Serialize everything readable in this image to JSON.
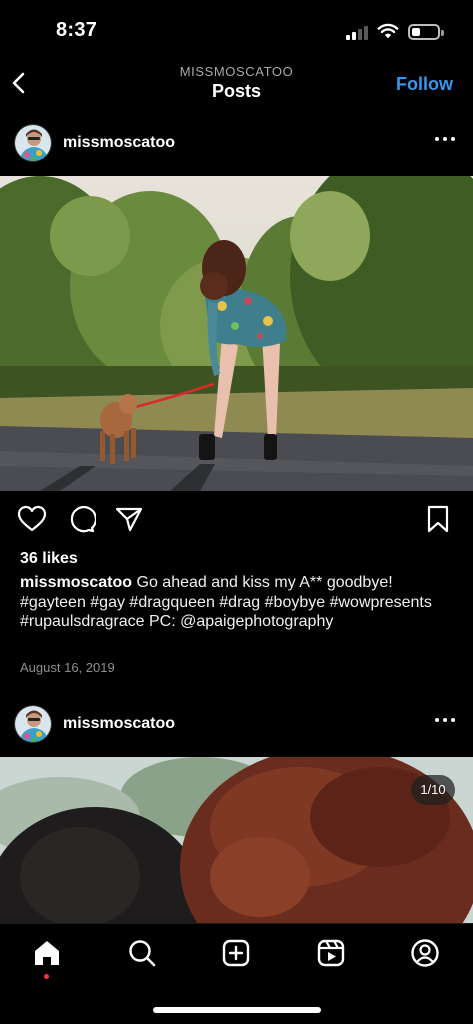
{
  "status_bar": {
    "time": "8:37",
    "battery_level": 0.35
  },
  "header": {
    "subtitle": "MISSMOSCATOO",
    "title": "Posts",
    "follow_label": "Follow",
    "back_icon": "chevron-left-icon"
  },
  "posts": [
    {
      "username": "missmoscatoo",
      "more_icon": "more-horizontal-icon",
      "likes": "36 likes",
      "caption_user": "missmoscatoo",
      "caption_text": "Go ahead and kiss my A** goodbye! #gayteen #gay #dragqueen #drag #boybye #wowpresents #rupaulsdragrace  PC: @apaigephotography",
      "date": "August 16, 2019"
    },
    {
      "username": "missmoscatoo",
      "more_icon": "more-horizontal-icon",
      "media_counter": "1/10"
    }
  ],
  "actions": [
    "heart-icon",
    "comment-icon",
    "share-icon",
    "bookmark-icon"
  ],
  "bottom_nav": [
    "home-icon",
    "search-icon",
    "create-icon",
    "reels-icon",
    "profile-icon"
  ],
  "colors": {
    "accent": "#3797f0",
    "background": "#000000",
    "notification_dot": "#ff3040"
  }
}
